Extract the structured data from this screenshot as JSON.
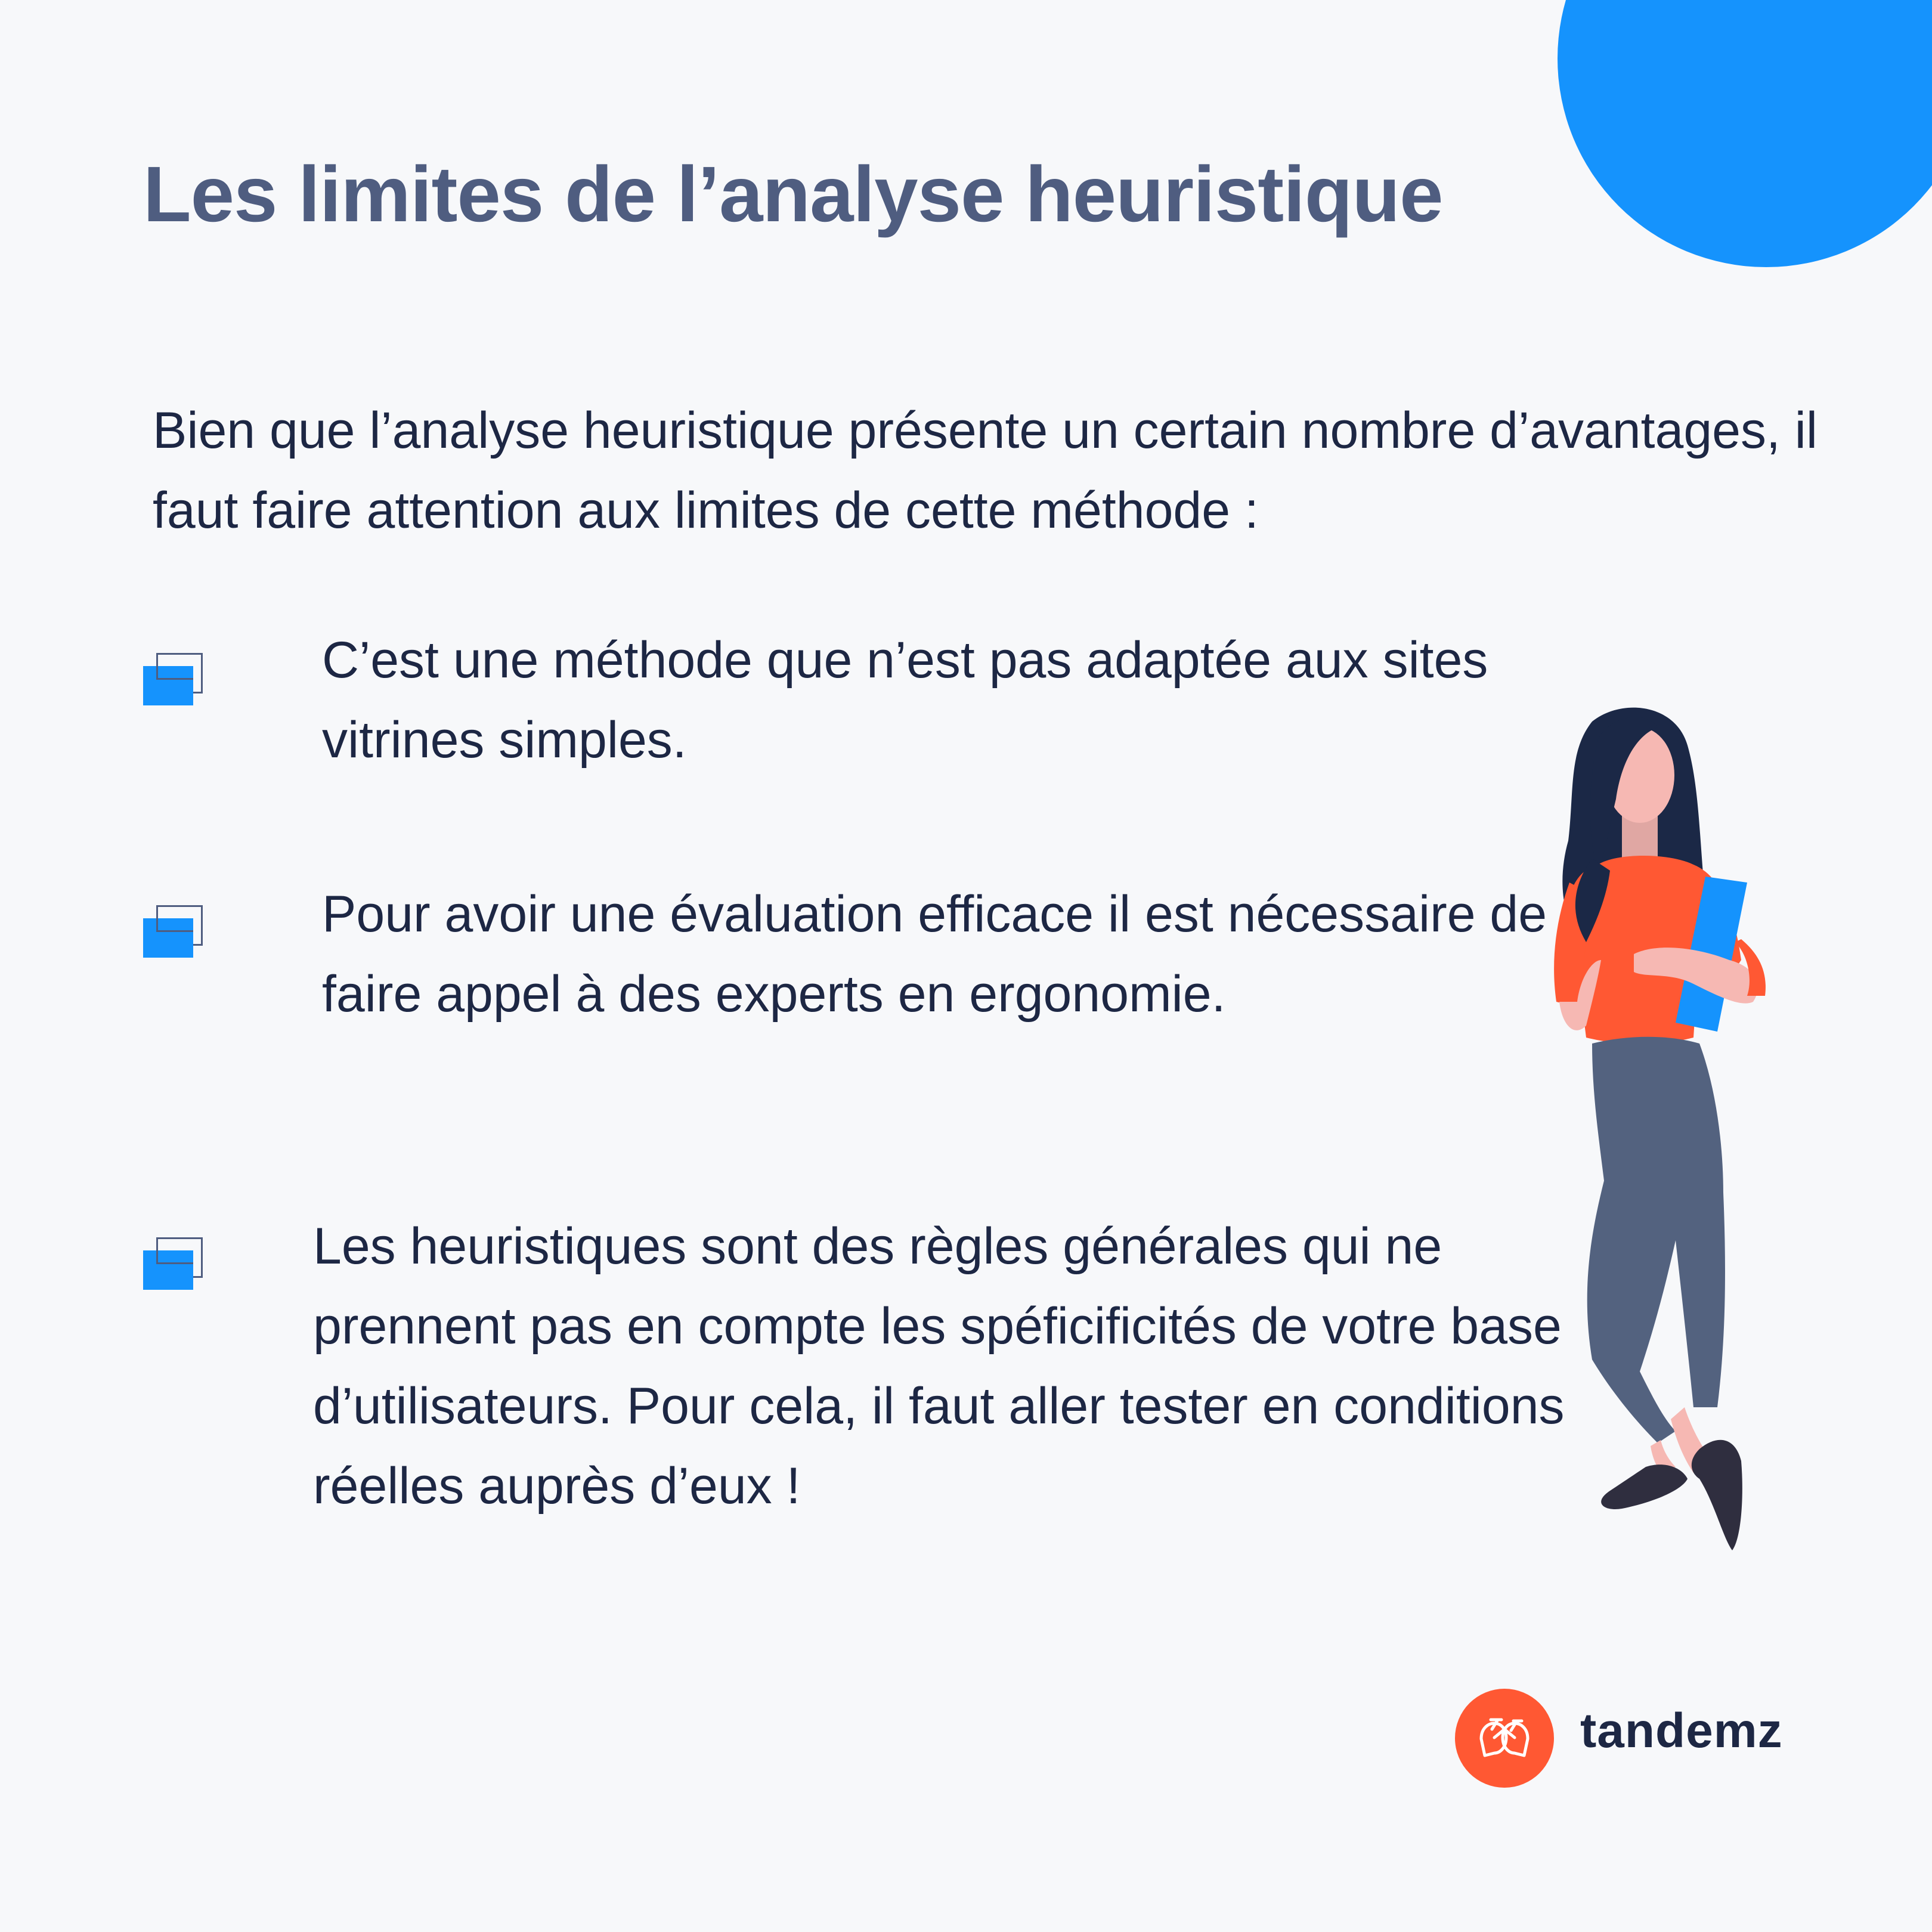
{
  "title": "Les limites de l’analyse heuristique",
  "intro": "Bien que l’analyse heuristique présente un certain nombre d’avantages, il faut faire attention aux limites de cette méthode :",
  "bullets": [
    "C’est une méthode que n’est pas adaptée aux sites vitrines simples.",
    "Pour avoir une évaluation efficace il est nécessaire de faire appel à des experts en ergonomie.",
    "Les heuristiques sont des règles générales qui ne prennent pas en compte les spéficificités de votre base d’utilisateurs. Pour cela, il faut aller tester en conditions réelles auprès d’eux !"
  ],
  "brand": {
    "name": "tandemz"
  },
  "colors": {
    "background": "#f7f8fa",
    "accent_blue": "#1593fd",
    "title_gray_blue": "#4f5d80",
    "text_navy": "#1d2744",
    "brand_orange": "#ff5833"
  },
  "icons": {
    "bullet": "stacked-squares-icon",
    "logo": "tandem-bike-logo-icon",
    "illustration": "woman-holding-folder-illustration"
  }
}
